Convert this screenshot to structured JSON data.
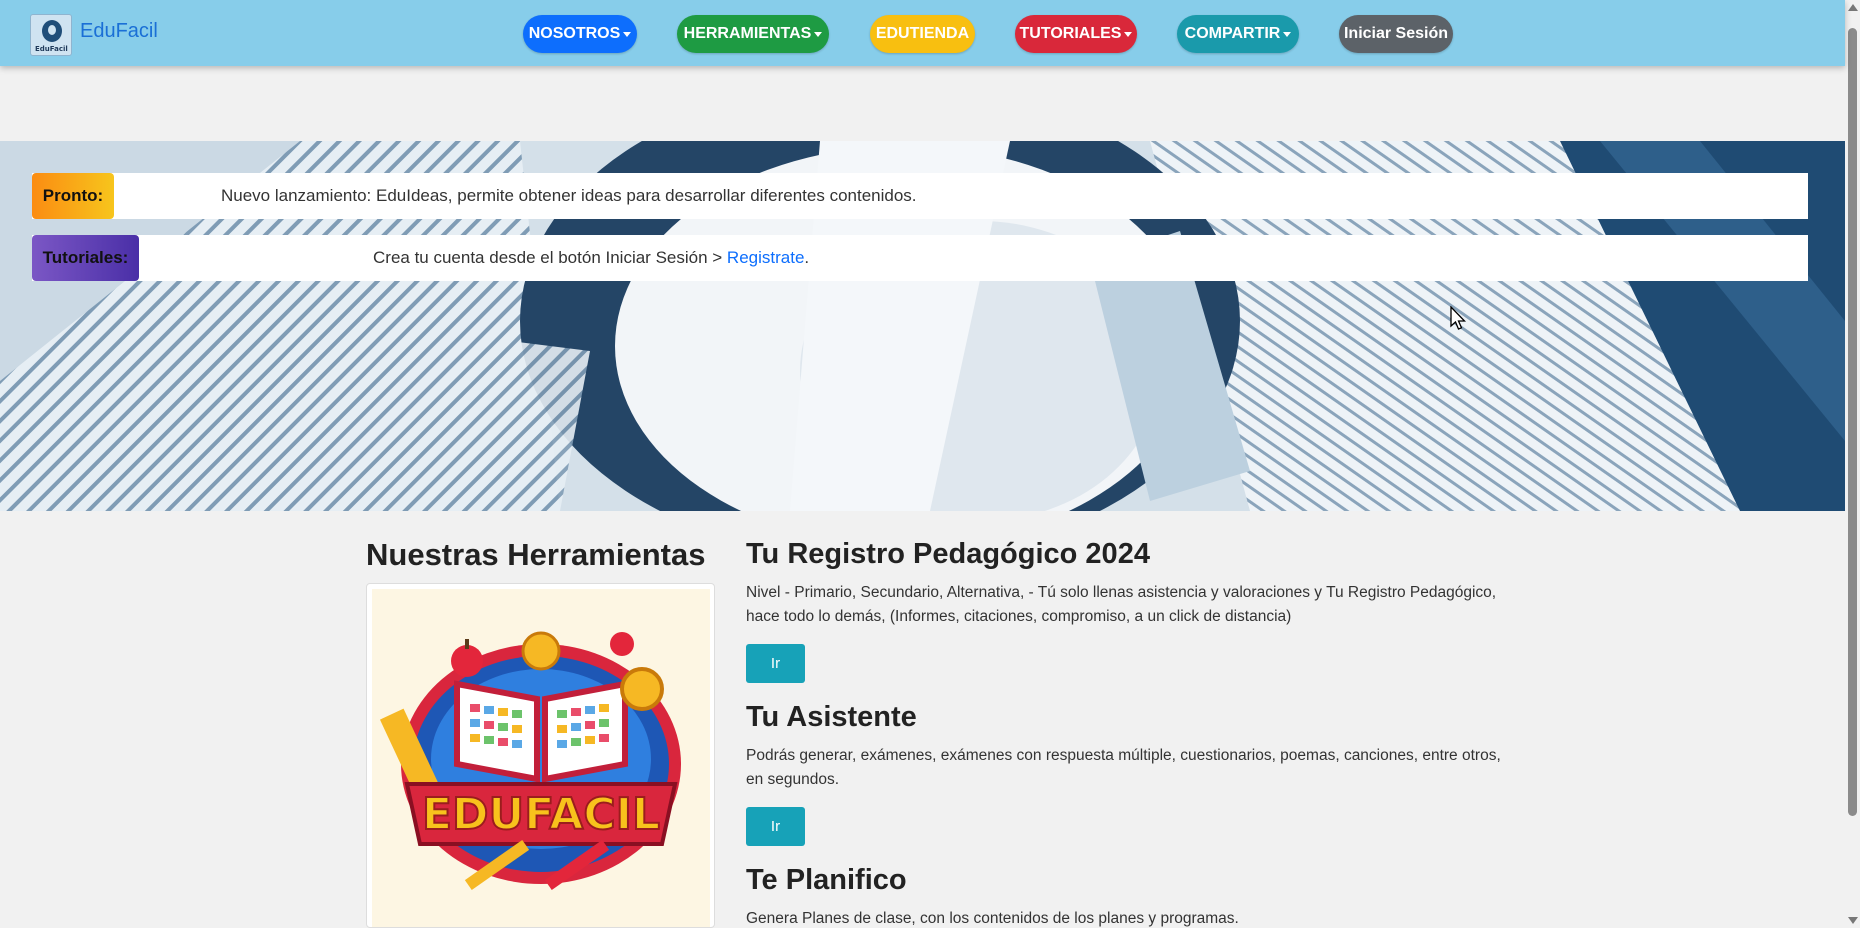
{
  "nav": {
    "brand": "EduFacil",
    "brand_logo_text": "EduFacil",
    "items": [
      {
        "label": "NOSOTROS",
        "dropdown": true
      },
      {
        "label": "HERRAMIENTAS",
        "dropdown": true
      },
      {
        "label": "EDUTIENDA",
        "dropdown": false
      },
      {
        "label": "TUTORIALES",
        "dropdown": true
      },
      {
        "label": "COMPARTIR",
        "dropdown": true
      }
    ],
    "login": "Iniciar Sesión"
  },
  "notices": [
    {
      "badge": "Pronto:",
      "text": "Nuevo lanzamiento: EduIdeas, permite obtener ideas para desarrollar diferentes contenidos."
    },
    {
      "badge": "Tutoriales:",
      "text_before": "Crea tu cuenta desde el botón Iniciar Sesión > ",
      "link": "Registrate",
      "text_after": "."
    }
  ],
  "tools": {
    "title": "Nuestras Herramientas",
    "logo_text": "EDUFACIL"
  },
  "items": [
    {
      "title": "Tu Registro Pedagógico 2024",
      "desc": "Nivel - Primario, Secundario, Alternativa, - Tú solo llenas asistencia y valoraciones y Tu Registro Pedagógico, hace todo lo demás, (Informes, citaciones, compromiso, a un click de distancia)",
      "button": "Ir"
    },
    {
      "title": "Tu Asistente",
      "desc": "Podrás generar, exámenes, exámenes con respuesta múltiple, cuestionarios, poemas, canciones, entre otros, en segundos.",
      "button": "Ir"
    },
    {
      "title": "Te Planifico",
      "desc": "Genera Planes de clase, con los contenidos de los planes y programas."
    }
  ],
  "colors": {
    "navbar": "#87cdea",
    "nosotros": "#0d6efd",
    "herramientas": "#1e9b43",
    "edutienda": "#f8bf10",
    "tutoriales": "#d9283a",
    "compartir": "#1a9aab",
    "login": "#5c6268",
    "ir_button": "#17a2b8"
  }
}
